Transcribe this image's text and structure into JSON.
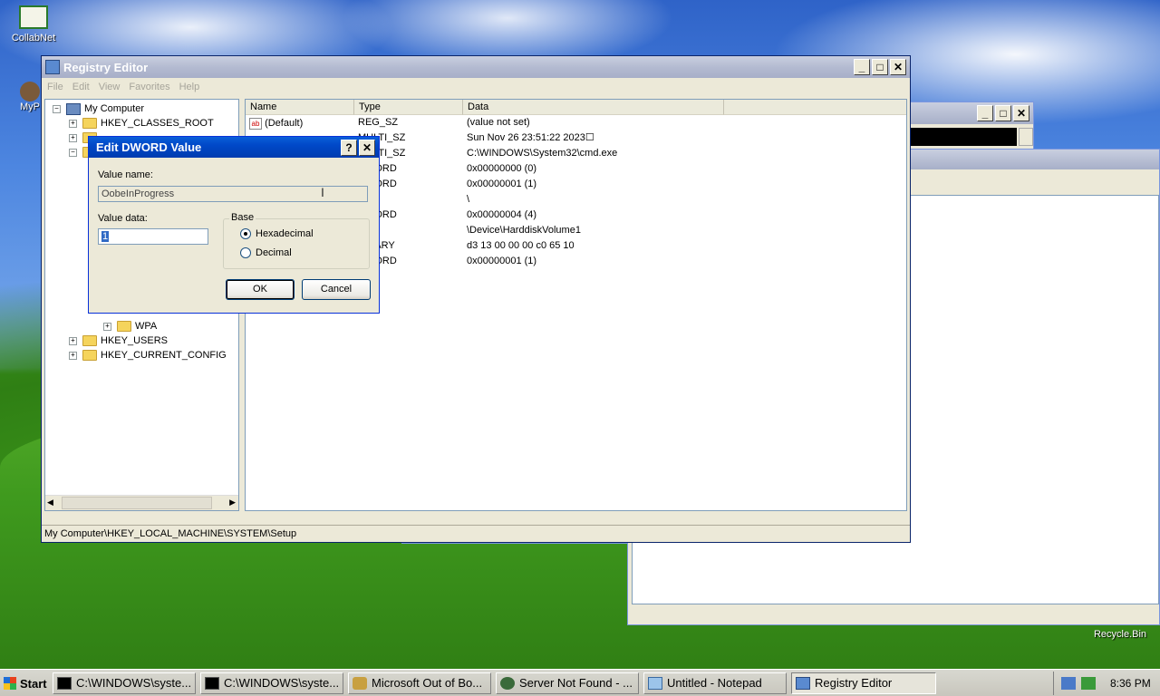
{
  "desktop": {
    "icons": [
      {
        "label": "CollabNet",
        "icon": "collabnet-icon"
      },
      {
        "label": "MyP",
        "icon": "my-profile-icon"
      },
      {
        "label": "Recycle.Bin",
        "icon": "recycle-bin-icon"
      }
    ]
  },
  "regedit": {
    "title": "Registry Editor",
    "menu": [
      "File",
      "Edit",
      "View",
      "Favorites",
      "Help"
    ],
    "tree": [
      {
        "label": "My Computer",
        "expander": "−"
      },
      {
        "label": "HKEY_CLASSES_ROOT",
        "expander": "+"
      },
      {
        "label": "WPA",
        "expander": "+"
      },
      {
        "label": "HKEY_USERS",
        "expander": "+"
      },
      {
        "label": "HKEY_CURRENT_CONFIG",
        "expander": "+"
      }
    ],
    "columns": [
      "Name",
      "Type",
      "Data"
    ],
    "rows": [
      {
        "name": "(Default)",
        "type": "REG_SZ",
        "data": "(value not set)"
      },
      {
        "name": "",
        "type": "MULTI_SZ",
        "data": "Sun Nov 26 23:51:22 2023☐"
      },
      {
        "name": "",
        "type": "MULTI_SZ",
        "data": "C:\\WINDOWS\\System32\\cmd.exe"
      },
      {
        "name": "",
        "type": "DWORD",
        "data": "0x00000000 (0)"
      },
      {
        "name": "",
        "type": "DWORD",
        "data": "0x00000001 (1)"
      },
      {
        "name": "",
        "type": "SZ",
        "data": "\\"
      },
      {
        "name": "",
        "type": "DWORD",
        "data": "0x00000004 (4)"
      },
      {
        "name": "",
        "type": "SZ",
        "data": "\\Device\\HarddiskVolume1"
      },
      {
        "name": "",
        "type": "BINARY",
        "data": "d3 13 00 00 00 c0 65 10"
      },
      {
        "name": "",
        "type": "DWORD",
        "data": "0x00000001 (1)"
      }
    ],
    "status": "My Computer\\HKEY_LOCAL_MACHINE\\SYSTEM\\Setup"
  },
  "dialog": {
    "title": "Edit DWORD Value",
    "help": "?",
    "close": "✕",
    "value_name_label": "Value name:",
    "value_name": "OobeInProgress",
    "value_data_label": "Value data:",
    "value_data": "1",
    "base_label": "Base",
    "hex_label": "Hexadecimal",
    "dec_label": "Decimal",
    "ok": "OK",
    "cancel": "Cancel"
  },
  "taskbar": {
    "start": "Start",
    "tasks": [
      {
        "label": "C:\\WINDOWS\\syste...",
        "icon": "console-icon"
      },
      {
        "label": "C:\\WINDOWS\\syste...",
        "icon": "console-icon"
      },
      {
        "label": "Microsoft Out of Bo...",
        "icon": "oobe-icon"
      },
      {
        "label": "Server Not Found - ...",
        "icon": "browser-icon"
      },
      {
        "label": "Untitled - Notepad",
        "icon": "notepad-icon"
      },
      {
        "label": "Registry Editor",
        "icon": "regedit-icon"
      }
    ],
    "clock": "8:36 PM"
  },
  "colors": {
    "title_active": "#0054e3",
    "window_face": "#ece9d8",
    "selection": "#316ac5"
  }
}
